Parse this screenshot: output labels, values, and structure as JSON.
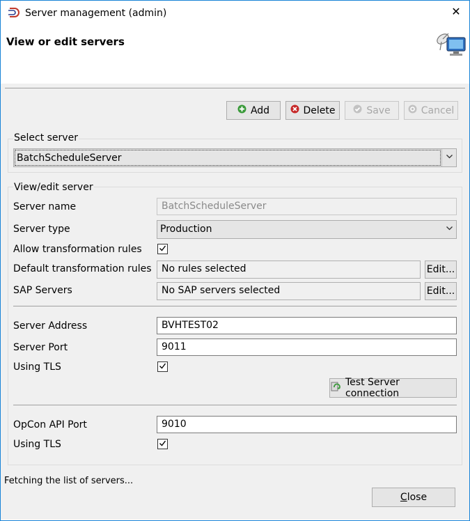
{
  "window": {
    "title": "Server management (admin)",
    "close_glyph": "✕",
    "app_icon": "app-logo-icon"
  },
  "header": {
    "title": "View or edit servers",
    "icon": "satellite-monitor-icon"
  },
  "toolbar": {
    "add_label": "Add",
    "delete_label": "Delete",
    "save_label": "Save",
    "cancel_label": "Cancel"
  },
  "select_server": {
    "group_label": "Select server",
    "selected": "BatchScheduleServer"
  },
  "view_edit": {
    "group_label": "View/edit server",
    "server_name_label": "Server name",
    "server_name_value": "BatchScheduleServer",
    "server_type_label": "Server type",
    "server_type_value": "Production",
    "allow_rules_label": "Allow transformation rules",
    "allow_rules_checked": true,
    "default_rules_label": "Default transformation rules",
    "default_rules_value": "No rules selected",
    "default_rules_edit": "Edit...",
    "sap_servers_label": "SAP Servers",
    "sap_servers_value": "No SAP servers selected",
    "sap_servers_edit": "Edit...",
    "server_address_label": "Server Address",
    "server_address_value": "BVHTEST02",
    "server_port_label": "Server Port",
    "server_port_value": "9011",
    "using_tls_label": "Using TLS",
    "using_tls_checked": true,
    "test_connection_label": "Test Server connection",
    "opcon_port_label": "OpCon API Port",
    "opcon_port_value": "9010",
    "opcon_tls_label": "Using TLS",
    "opcon_tls_checked": true
  },
  "status_text": "Fetching the list of servers...",
  "close_button": {
    "label_first": "C",
    "label_rest": "lose"
  },
  "colors": {
    "window_border": "#1883d7",
    "add_green": "#3a9a3a",
    "delete_red": "#c62828",
    "panel_bg": "#f0f0f0"
  }
}
